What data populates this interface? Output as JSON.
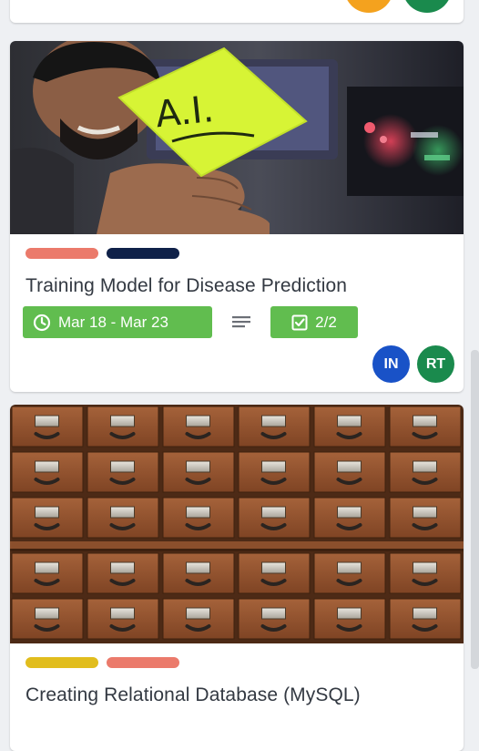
{
  "cards": [
    {
      "title": "Training Model for Disease Prediction",
      "cover_note": "A.I.",
      "labels": [
        {
          "color": "#eb7a6b"
        },
        {
          "color": "#0f2149"
        }
      ],
      "badges": {
        "due": "Mar 18 - Mar 23",
        "checklist": "2/2"
      },
      "members": [
        {
          "initials": "IN",
          "color": "#1952c7"
        },
        {
          "initials": "RT",
          "color": "#1a8a4d"
        }
      ]
    },
    {
      "title": "Creating Relational Database (MySQL)",
      "labels": [
        {
          "color": "#e1bd1d"
        },
        {
          "color": "#eb7a6b"
        }
      ]
    }
  ],
  "colors": {
    "badge_green": "#61bd4f",
    "avatar_orange": "#f4a21e",
    "avatar_green": "#1a8a4d"
  },
  "icons": [
    "clock-icon",
    "description-icon",
    "checklist-icon"
  ]
}
